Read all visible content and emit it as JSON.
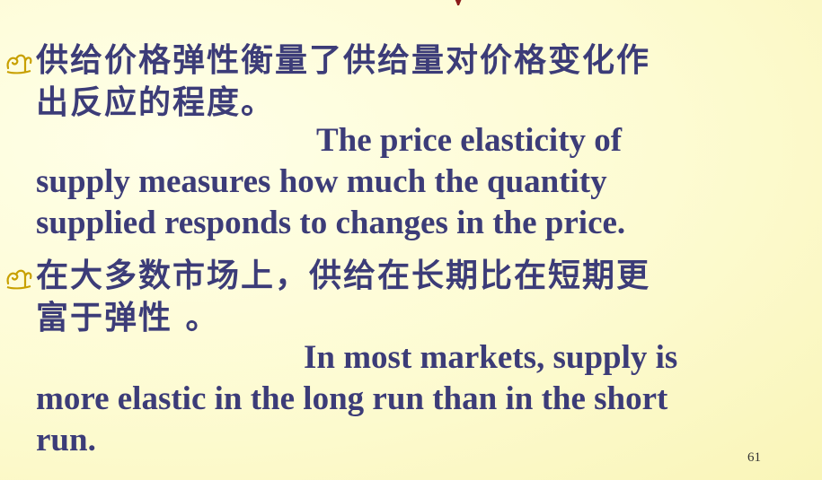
{
  "bullets": [
    {
      "icon": "scroll-bullet-icon",
      "zh_line1": "供给价格弹性衡量了供给量对价格变化作",
      "zh_line2": "出反应的程度。",
      "en_line1": "The price elasticity of",
      "en_line2": "supply measures how much the quantity",
      "en_line3": "supplied responds to changes in the price."
    },
    {
      "icon": "scroll-bullet-icon",
      "zh_line1": "在大多数市场上，供给在长期比在短期更",
      "zh_line2": "富于弹性 。",
      "en_line1": "In most markets, supply is",
      "en_line2": "more elastic in the long run than in the short",
      "en_line3": "run."
    }
  ],
  "page_number": "61",
  "colors": {
    "text": "#3c3c78",
    "bullet": "#c8a000",
    "title_accent": "#8b1a1a"
  }
}
